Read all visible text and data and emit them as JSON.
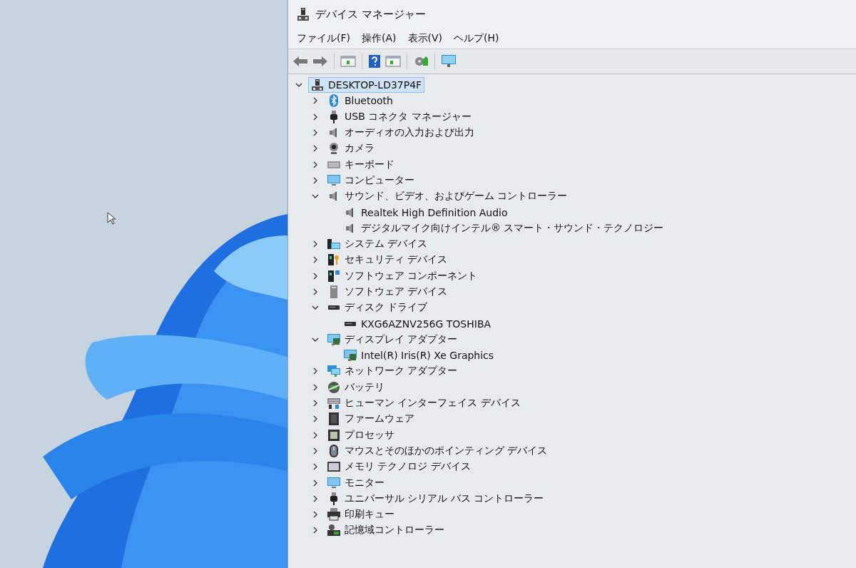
{
  "window": {
    "title": "デバイス マネージャー"
  },
  "menu": [
    {
      "label": "ファイル(F)"
    },
    {
      "label": "操作(A)"
    },
    {
      "label": "表示(V)"
    },
    {
      "label": "ヘルプ(H)"
    }
  ],
  "tree": {
    "label": "DESKTOP-LD37P4F",
    "kind": "computer",
    "expanded": true,
    "selected": true,
    "children": [
      {
        "label": "Bluetooth",
        "kind": "bluetooth",
        "expanded": false,
        "selected": false
      },
      {
        "label": "USB コネクタ マネージャー",
        "kind": "usb",
        "expanded": false,
        "selected": false
      },
      {
        "label": "オーディオの入力および出力",
        "kind": "speaker",
        "expanded": false,
        "selected": false
      },
      {
        "label": "カメラ",
        "kind": "camera",
        "expanded": false,
        "selected": false
      },
      {
        "label": "キーボード",
        "kind": "keyboard",
        "expanded": false,
        "selected": false
      },
      {
        "label": "コンピューター",
        "kind": "monitor",
        "expanded": false,
        "selected": false
      },
      {
        "label": "サウンド、ビデオ、およびゲーム コントローラー",
        "kind": "speaker",
        "expanded": true,
        "selected": false,
        "children": [
          {
            "label": "Realtek High Definition Audio",
            "kind": "speaker",
            "selected": false
          },
          {
            "label": "デジタルマイク向けインテル® スマート・サウンド・テクノロジー",
            "kind": "speaker",
            "selected": false
          }
        ]
      },
      {
        "label": "システム デバイス",
        "kind": "system",
        "expanded": false,
        "selected": false
      },
      {
        "label": "セキュリティ デバイス",
        "kind": "security",
        "expanded": false,
        "selected": false
      },
      {
        "label": "ソフトウェア コンポーネント",
        "kind": "component",
        "expanded": false,
        "selected": false
      },
      {
        "label": "ソフトウェア デバイス",
        "kind": "tower",
        "expanded": false,
        "selected": false
      },
      {
        "label": "ディスク ドライブ",
        "kind": "disk",
        "expanded": true,
        "selected": false,
        "children": [
          {
            "label": "KXG6AZNV256G TOSHIBA",
            "kind": "disk",
            "selected": false
          }
        ]
      },
      {
        "label": "ディスプレイ アダプター",
        "kind": "display",
        "expanded": true,
        "selected": false,
        "children": [
          {
            "label": "Intel(R) Iris(R) Xe Graphics",
            "kind": "display",
            "selected": false
          }
        ]
      },
      {
        "label": "ネットワーク アダプター",
        "kind": "network",
        "expanded": false,
        "selected": false
      },
      {
        "label": "バッテリ",
        "kind": "battery",
        "expanded": false,
        "selected": false
      },
      {
        "label": "ヒューマン インターフェイス デバイス",
        "kind": "hid",
        "expanded": false,
        "selected": false
      },
      {
        "label": "ファームウェア",
        "kind": "firmware",
        "expanded": false,
        "selected": false
      },
      {
        "label": "プロセッサ",
        "kind": "chip",
        "expanded": false,
        "selected": false
      },
      {
        "label": "マウスとそのほかのポインティング デバイス",
        "kind": "mouse",
        "expanded": false,
        "selected": false
      },
      {
        "label": "メモリ テクノロジ デバイス",
        "kind": "memory",
        "expanded": false,
        "selected": false
      },
      {
        "label": "モニター",
        "kind": "monitor",
        "expanded": false,
        "selected": false
      },
      {
        "label": "ユニバーサル シリアル バス コントローラー",
        "kind": "usb",
        "expanded": false,
        "selected": false
      },
      {
        "label": "印刷キュー",
        "kind": "printer",
        "expanded": false,
        "selected": false
      },
      {
        "label": "記憶域コントローラー",
        "kind": "storage",
        "expanded": false,
        "selected": false
      }
    ]
  }
}
